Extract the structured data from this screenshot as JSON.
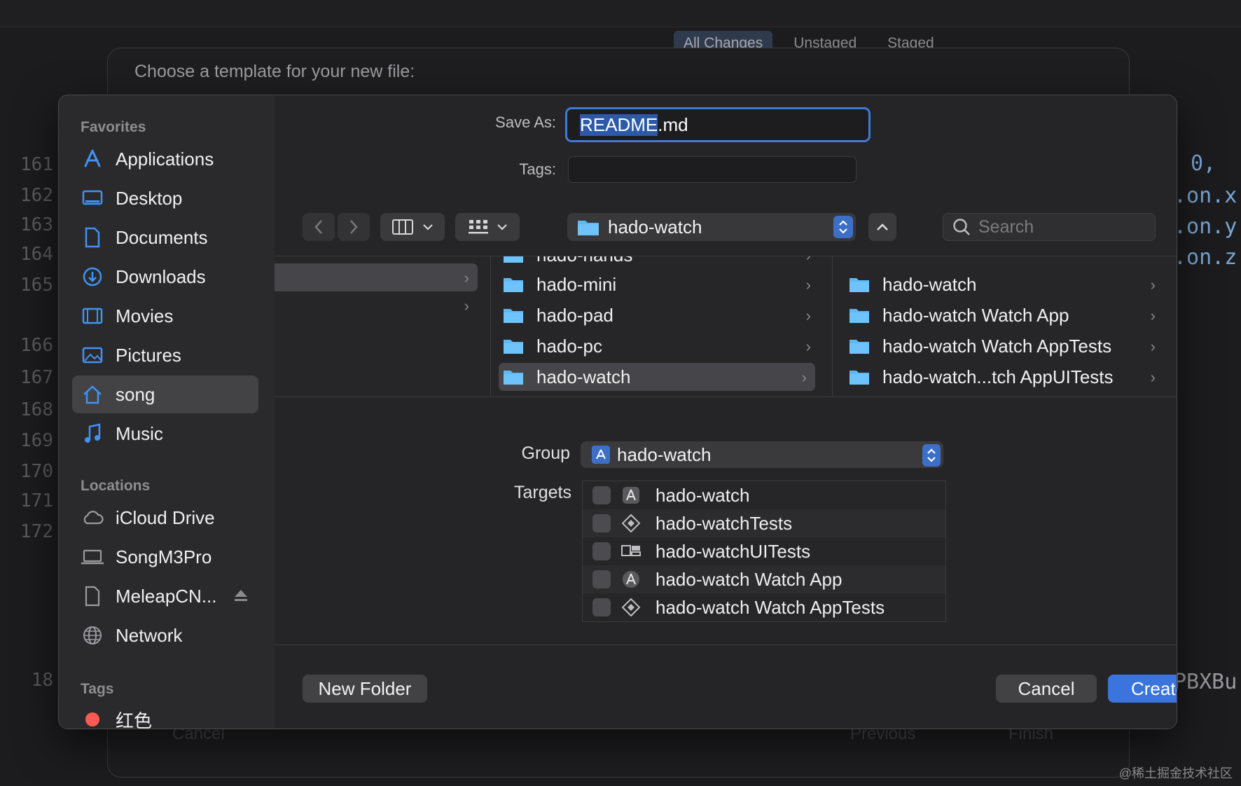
{
  "background": {
    "scm_tabs": [
      "All Changes",
      "Unstaged",
      "Staged"
    ],
    "template_title": "Choose a template for your new file:",
    "line_numbers": [
      "161",
      "162",
      "163",
      "164",
      "165",
      "166",
      "167",
      "168",
      "169",
      "170",
      "171",
      "172",
      "18"
    ],
    "code_fragments": [
      "0,",
      ".on.x",
      ".on.y",
      ".on.z",
      "PBXBu"
    ],
    "ghost_buttons": {
      "cancel": "Cancel",
      "previous": "Previous",
      "finish": "Finish"
    }
  },
  "sidebar": {
    "favorites_title": "Favorites",
    "favorites": [
      {
        "label": "Applications",
        "icon": "applications-icon"
      },
      {
        "label": "Desktop",
        "icon": "desktop-icon"
      },
      {
        "label": "Documents",
        "icon": "document-icon"
      },
      {
        "label": "Downloads",
        "icon": "downloads-icon"
      },
      {
        "label": "Movies",
        "icon": "movies-icon"
      },
      {
        "label": "Pictures",
        "icon": "pictures-icon"
      },
      {
        "label": "song",
        "icon": "home-icon",
        "selected": true
      },
      {
        "label": "Music",
        "icon": "music-icon"
      }
    ],
    "locations_title": "Locations",
    "locations": [
      {
        "label": "iCloud Drive",
        "icon": "cloud-icon"
      },
      {
        "label": "SongM3Pro",
        "icon": "laptop-icon"
      },
      {
        "label": "MeleapCN...",
        "icon": "file-icon",
        "eject": true
      },
      {
        "label": "Network",
        "icon": "globe-icon"
      }
    ],
    "tags_title": "Tags",
    "tags": [
      {
        "label": "红色",
        "color": "#ff5a52"
      }
    ]
  },
  "form": {
    "save_as_label": "Save As:",
    "save_as_name": "README",
    "save_as_ext": ".md",
    "tags_label": "Tags:",
    "location": "hado-watch",
    "search_placeholder": "Search"
  },
  "browser": {
    "col2": [
      {
        "name": "hado-hands"
      },
      {
        "name": "hado-mini"
      },
      {
        "name": "hado-pad"
      },
      {
        "name": "hado-pc"
      },
      {
        "name": "hado-watch",
        "selected": true
      }
    ],
    "col3": [
      {
        "name": "hado-watch"
      },
      {
        "name": "hado-watch Watch App"
      },
      {
        "name": "hado-watch Watch AppTests"
      },
      {
        "name": "hado-watch...tch AppUITests"
      }
    ]
  },
  "group": {
    "label": "Group",
    "value": "hado-watch"
  },
  "targets": {
    "label": "Targets",
    "items": [
      {
        "name": "hado-watch",
        "icon": "app-target-icon",
        "checked": false
      },
      {
        "name": "hado-watchTests",
        "icon": "test-target-icon",
        "checked": false
      },
      {
        "name": "hado-watchUITests",
        "icon": "uitest-target-icon",
        "checked": false
      },
      {
        "name": "hado-watch Watch App",
        "icon": "watch-app-target-icon",
        "checked": false
      },
      {
        "name": "hado-watch Watch AppTests",
        "icon": "test-target-icon",
        "checked": false
      }
    ]
  },
  "buttons": {
    "new_folder": "New Folder",
    "cancel": "Cancel",
    "create": "Create"
  },
  "watermark": "@稀土掘金技术社区",
  "colors": {
    "accent": "#3a74dc",
    "folder": "#5fb8f6",
    "tag_red": "#ff5a52"
  }
}
